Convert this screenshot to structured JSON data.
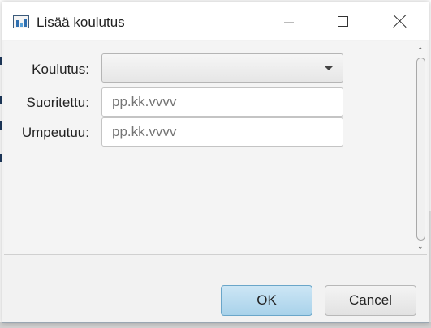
{
  "dialog": {
    "title": "Lisää koulutus"
  },
  "form": {
    "koulutus_label": "Koulutus:",
    "koulutus_value": "",
    "suoritettu_label": "Suoritettu:",
    "suoritettu_placeholder": "pp.kk.vvvv",
    "umpeutuu_label": "Umpeutuu:",
    "umpeutuu_placeholder": "pp.kk.vvvv"
  },
  "buttons": {
    "ok_label": "OK",
    "cancel_label": "Cancel"
  },
  "colors": {
    "ok_button_accent": "#a8d2ea",
    "dialog_background": "#f2f2f2"
  }
}
